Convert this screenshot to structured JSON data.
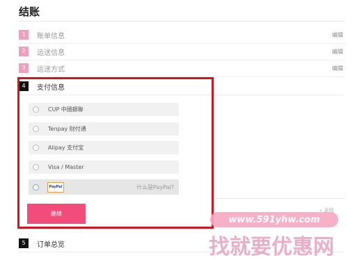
{
  "page": {
    "title": "结账"
  },
  "steps": [
    {
      "num": "1",
      "label": "账单信息",
      "edit": "编辑"
    },
    {
      "num": "2",
      "label": "运送信息",
      "edit": "编辑"
    },
    {
      "num": "3",
      "label": "运送方式",
      "edit": "编辑"
    },
    {
      "num": "4",
      "label": "支付信息",
      "edit": ""
    },
    {
      "num": "5",
      "label": "订单总览",
      "edit": ""
    }
  ],
  "payment": {
    "options": [
      {
        "label": "CUP 中國銀聯"
      },
      {
        "label": "Tenpay 财付通"
      },
      {
        "label": "Alipay 支付宝"
      },
      {
        "label": "Visa / Master"
      }
    ],
    "paypal": {
      "logo_text": "PayPal",
      "what_is": "什么是PayPal?"
    },
    "continue_label": "继续",
    "back_label": "« 返回"
  },
  "watermark": {
    "url": "www.591yhw.com",
    "text": "找就要优惠网"
  },
  "colors": {
    "accent": "#f14c7a",
    "step_badge": "#f0a0bc",
    "highlight": "#d3131d"
  }
}
